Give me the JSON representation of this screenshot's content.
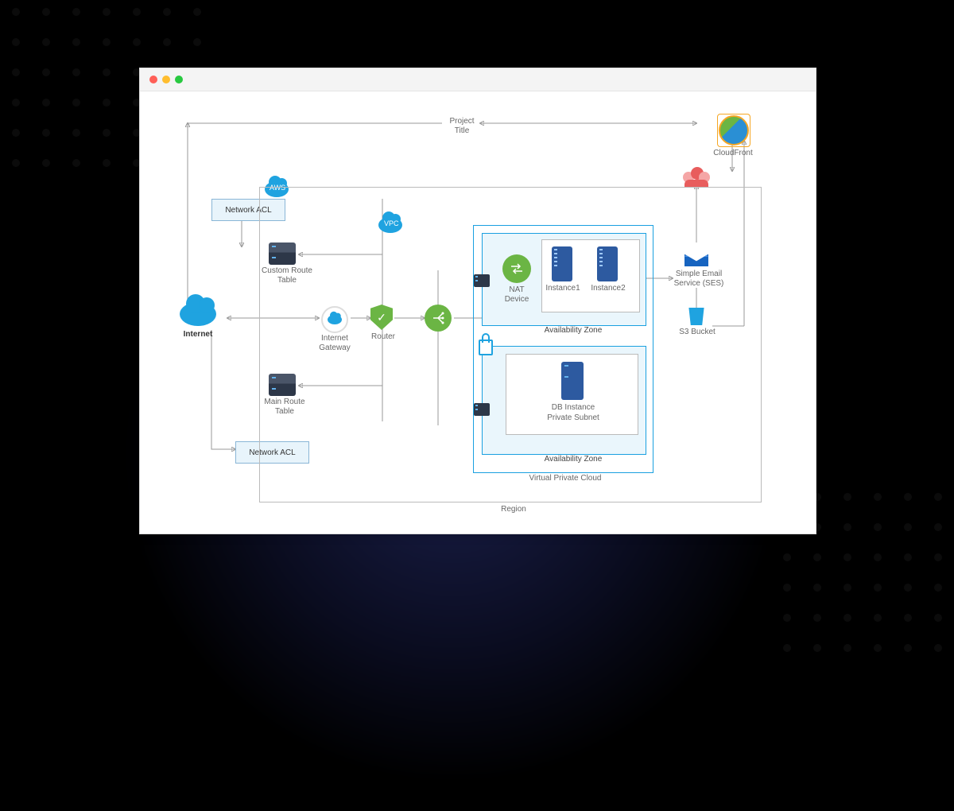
{
  "project_title_line1": "Project",
  "project_title_line2": "Title",
  "nodes": {
    "cloudfront": "CloudFront",
    "internet": "Internet",
    "aws_cloud": "AWS",
    "vpc_cloud": "VPC",
    "network_acl_top": "Network ACL",
    "network_acl_bottom": "Network ACL",
    "custom_route_table": "Custom Route Table",
    "main_route_table": "Main Route Table",
    "internet_gateway": "Internet Gateway",
    "router": "Router",
    "nat_device": "NAT Device",
    "instance1": "Instance1",
    "instance2": "Instance2",
    "db_instance": "DB Instance",
    "private_subnet": "Private Subnet",
    "ses_line1": "Simple Email",
    "ses_line2": "Service (SES)",
    "s3_bucket": "S3 Bucket",
    "az_label": "Availability Zone",
    "vpc_label": "Virtual Private Cloud",
    "region_label": "Region"
  }
}
